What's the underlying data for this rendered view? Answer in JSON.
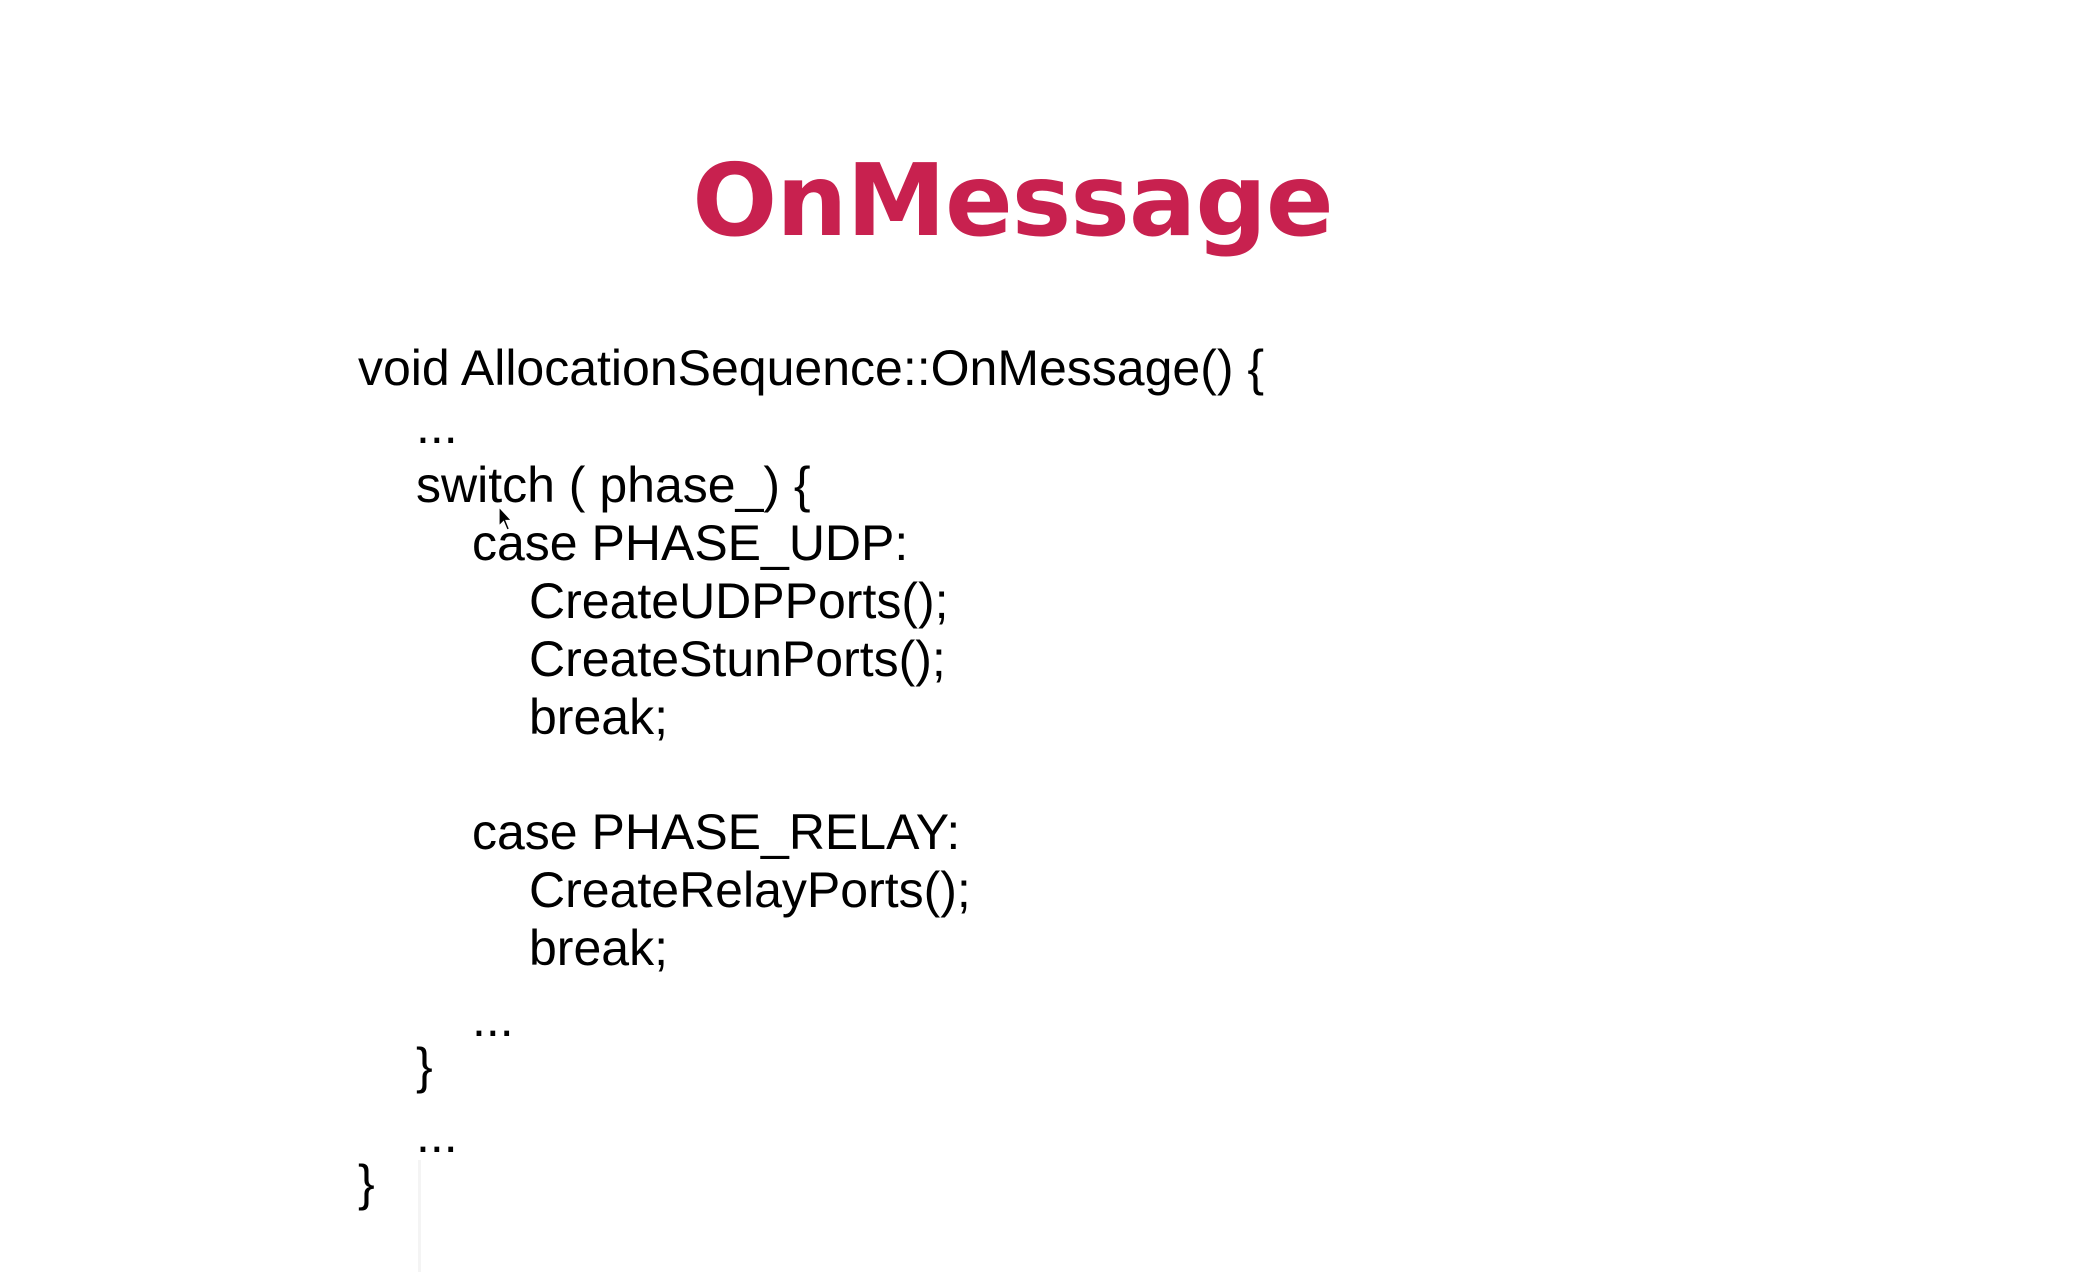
{
  "slide": {
    "title": "OnMessage",
    "title_color": "#c8214f",
    "code_lines": [
      "void AllocationSequence::OnMessage() {",
      "...",
      "switch ( phase_) {",
      "case PHASE_UDP:",
      "CreateUDPPorts();",
      "CreateStunPorts();",
      "break;",
      "case PHASE_RELAY:",
      "CreateRelayPorts();",
      "break;",
      "...",
      "}",
      "...",
      "}"
    ],
    "cursor_icon": "mouse-pointer-icon"
  }
}
